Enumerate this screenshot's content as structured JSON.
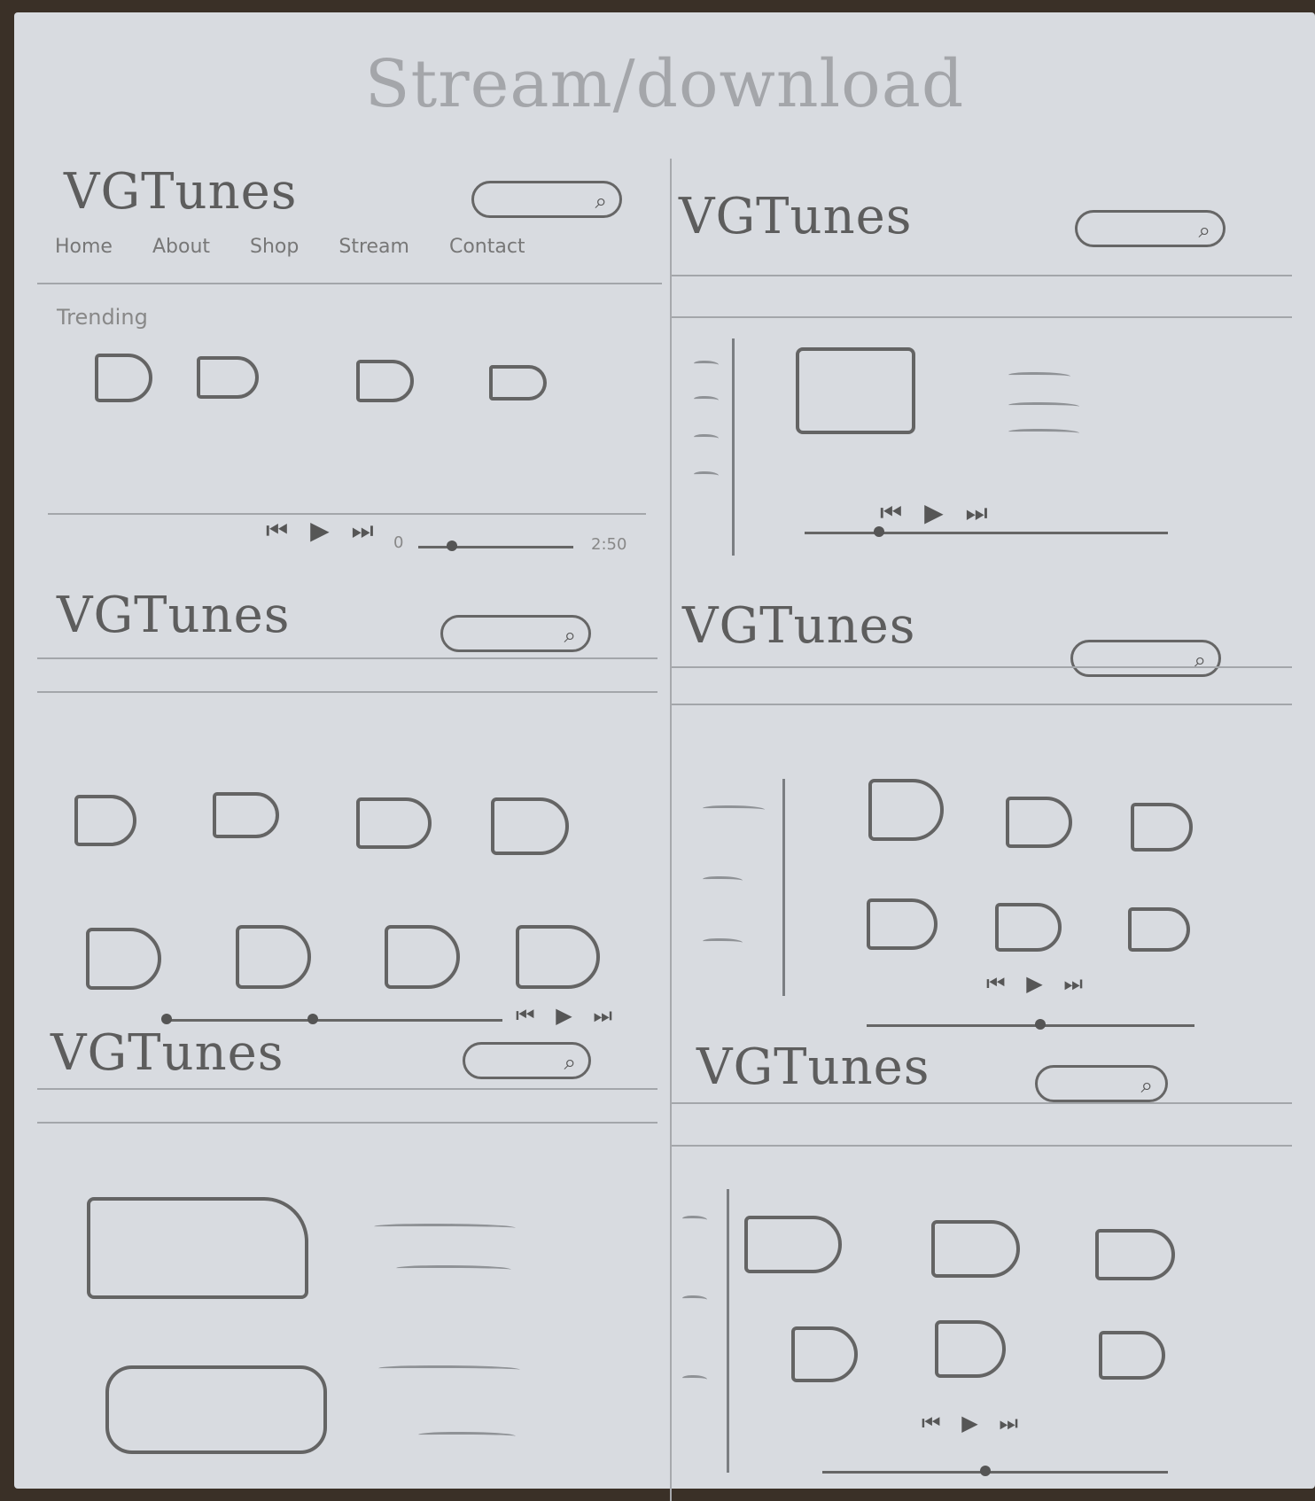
{
  "page": {
    "title": "Stream/download"
  },
  "panels": [
    {
      "brand": "VGTunes",
      "nav": [
        "Home",
        "About",
        "Shop",
        "Stream",
        "Contact"
      ],
      "section": "Trending",
      "player": {
        "controls": "⏮ ▶ ⏭",
        "start_time": "0",
        "end_time": "2:50"
      }
    },
    {
      "brand": "VGTunes",
      "player": {
        "controls": "⏮ ▶ ⏭"
      }
    },
    {
      "brand": "VGTunes",
      "player": {
        "controls": "⏮ ▶ ⏭"
      }
    },
    {
      "brand": "VGTunes",
      "player": {
        "controls": "⏮ ▶ ⏭"
      }
    },
    {
      "brand": "VGTunes"
    },
    {
      "brand": "VGTunes",
      "player": {
        "controls": "⏮ ▶ ⏭"
      }
    }
  ],
  "icons": {
    "search": "search-icon",
    "previous": "previous-icon",
    "play": "play-icon",
    "next": "next-icon"
  }
}
